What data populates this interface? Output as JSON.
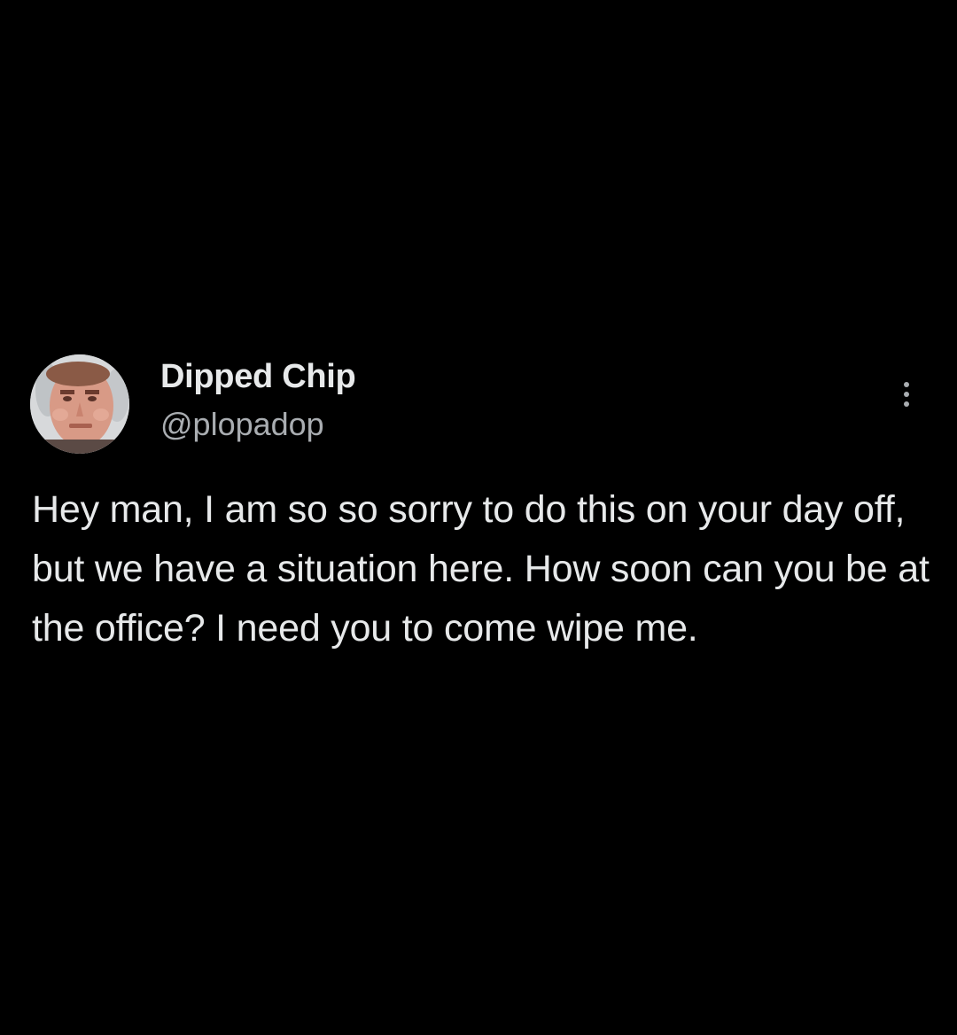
{
  "tweet": {
    "author": {
      "display_name": "Dipped Chip",
      "handle": "@plopadop"
    },
    "text": "Hey man, I am so so sorry to do this on your day off, but we have a situation here. How soon can you be at the office? I need you to come wipe me.",
    "more_icon": "more-vertical-icon"
  },
  "colors": {
    "background": "#000000",
    "text_primary": "#e7e9ea",
    "text_secondary": "#a9adb1"
  }
}
